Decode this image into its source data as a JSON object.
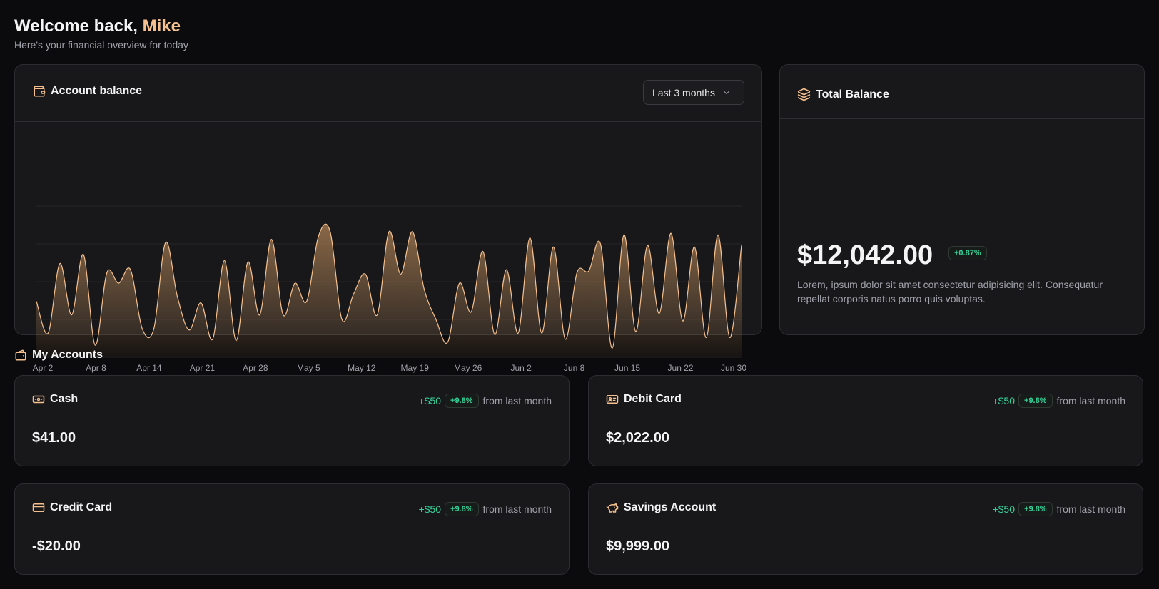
{
  "header": {
    "welcome_prefix": "Welcome back,",
    "user_name": "Mike",
    "subtitle": "Here's your financial overview for today"
  },
  "balance_chart_card": {
    "title": "Account balance",
    "range_label": "Last 3 months"
  },
  "total_card": {
    "title": "Total Balance",
    "amount": "$12,042.00",
    "change_pill": "+0.87%",
    "description": "Lorem, ipsum dolor sit amet consectetur adipisicing elit. Consequatur repellat corporis natus porro quis voluptas."
  },
  "accounts_section": {
    "title": "My Accounts",
    "accounts": [
      {
        "name": "Cash",
        "icon": "banknote-icon",
        "amount": "$41.00",
        "delta": "+$50",
        "pill": "+9.8%",
        "from": "from last month"
      },
      {
        "name": "Debit Card",
        "icon": "id-card-icon",
        "amount": "$2,022.00",
        "delta": "+$50",
        "pill": "+9.8%",
        "from": "from last month"
      },
      {
        "name": "Credit Card",
        "icon": "credit-card-icon",
        "amount": "-$20.00",
        "delta": "+$50",
        "pill": "+9.8%",
        "from": "from last month"
      },
      {
        "name": "Savings Account",
        "icon": "piggy-bank-icon",
        "amount": "$9,999.00",
        "delta": "+$50",
        "pill": "+9.8%",
        "from": "from last month"
      }
    ]
  },
  "colors": {
    "accent": "#f5c08e",
    "positive": "#34d399",
    "background": "#0b0b0d",
    "card": "#18181b"
  },
  "chart_data": {
    "type": "area",
    "x_tick_labels": [
      "Apr 2",
      "Apr 8",
      "Apr 14",
      "Apr 21",
      "Apr 28",
      "May 5",
      "May 12",
      "May 19",
      "May 26",
      "Jun 2",
      "Jun 8",
      "Jun 15",
      "Jun 22",
      "Jun 30"
    ],
    "values": [
      0.37,
      0.16,
      0.62,
      0.28,
      0.68,
      0.08,
      0.56,
      0.49,
      0.58,
      0.19,
      0.19,
      0.76,
      0.4,
      0.18,
      0.36,
      0.12,
      0.64,
      0.11,
      0.63,
      0.28,
      0.78,
      0.28,
      0.49,
      0.37,
      0.8,
      0.83,
      0.25,
      0.42,
      0.55,
      0.28,
      0.83,
      0.55,
      0.83,
      0.45,
      0.25,
      0.1,
      0.49,
      0.3,
      0.7,
      0.15,
      0.58,
      0.16,
      0.79,
      0.16,
      0.73,
      0.12,
      0.56,
      0.57,
      0.75,
      0.06,
      0.81,
      0.17,
      0.74,
      0.29,
      0.82,
      0.24,
      0.73,
      0.13,
      0.81,
      0.13,
      0.74
    ],
    "ylim": [
      0,
      1
    ],
    "grid": true,
    "y_gridlines": 5
  }
}
